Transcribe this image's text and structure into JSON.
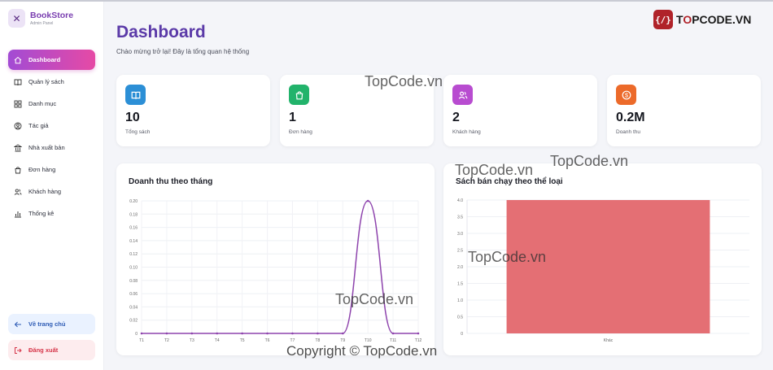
{
  "brand": {
    "title": "BookStore",
    "subtitle": "Admin Panel"
  },
  "nav": [
    {
      "label": "Dashboard",
      "icon": "home-icon",
      "active": true
    },
    {
      "label": "Quản lý sách",
      "icon": "book-icon"
    },
    {
      "label": "Danh mục",
      "icon": "grid-icon"
    },
    {
      "label": "Tác giả",
      "icon": "user-circle-icon"
    },
    {
      "label": "Nhà xuất bản",
      "icon": "building-icon"
    },
    {
      "label": "Đơn hàng",
      "icon": "bag-icon"
    },
    {
      "label": "Khách hàng",
      "icon": "users-icon"
    },
    {
      "label": "Thống kê",
      "icon": "bar-chart-icon"
    }
  ],
  "bottom": {
    "home": "Về trang chủ",
    "logout": "Đăng xuất"
  },
  "header": {
    "title": "Dashboard",
    "subtitle": "Chào mừng trở lại! Đây là tổng quan hệ thống"
  },
  "stats": [
    {
      "value": "10",
      "label": "Tổng sách",
      "color": "#2c8fd6",
      "icon": "book-icon"
    },
    {
      "value": "1",
      "label": "Đơn hàng",
      "color": "#22b36b",
      "icon": "bag-icon"
    },
    {
      "value": "2",
      "label": "Khách hàng",
      "color": "#b84cd0",
      "icon": "users-icon"
    },
    {
      "value": "0.2M",
      "label": "Doanh thu",
      "color": "#ec6a2a",
      "icon": "dollar-icon"
    }
  ],
  "watermark": {
    "logo": "TOPCODE.VN",
    "text": "TopCode.vn",
    "copyright": "Copyright © TopCode.vn"
  },
  "chart_data": [
    {
      "type": "line",
      "title": "Doanh thu theo tháng",
      "categories": [
        "T1",
        "T2",
        "T3",
        "T4",
        "T5",
        "T6",
        "T7",
        "T8",
        "T9",
        "T10",
        "T11",
        "T12"
      ],
      "values": [
        0,
        0,
        0,
        0,
        0,
        0,
        0,
        0,
        0,
        0.2,
        0,
        0
      ],
      "yticks": [
        "0",
        "0.02",
        "0.04",
        "0.06",
        "0.08",
        "0.10",
        "0.12",
        "0.14",
        "0.16",
        "0.18",
        "0.20"
      ],
      "ylim": [
        0,
        0.2
      ],
      "color": "#8e44ad",
      "grid": true
    },
    {
      "type": "bar",
      "title": "Sách bán chạy theo thể loại",
      "categories": [
        "Khác"
      ],
      "values": [
        4
      ],
      "yticks": [
        "0",
        "0.5",
        "1.0",
        "1.5",
        "2.0",
        "2.5",
        "3.0",
        "3.5",
        "4.0"
      ],
      "ylim": [
        0,
        4
      ],
      "color": "#e46f74",
      "grid": true
    }
  ]
}
